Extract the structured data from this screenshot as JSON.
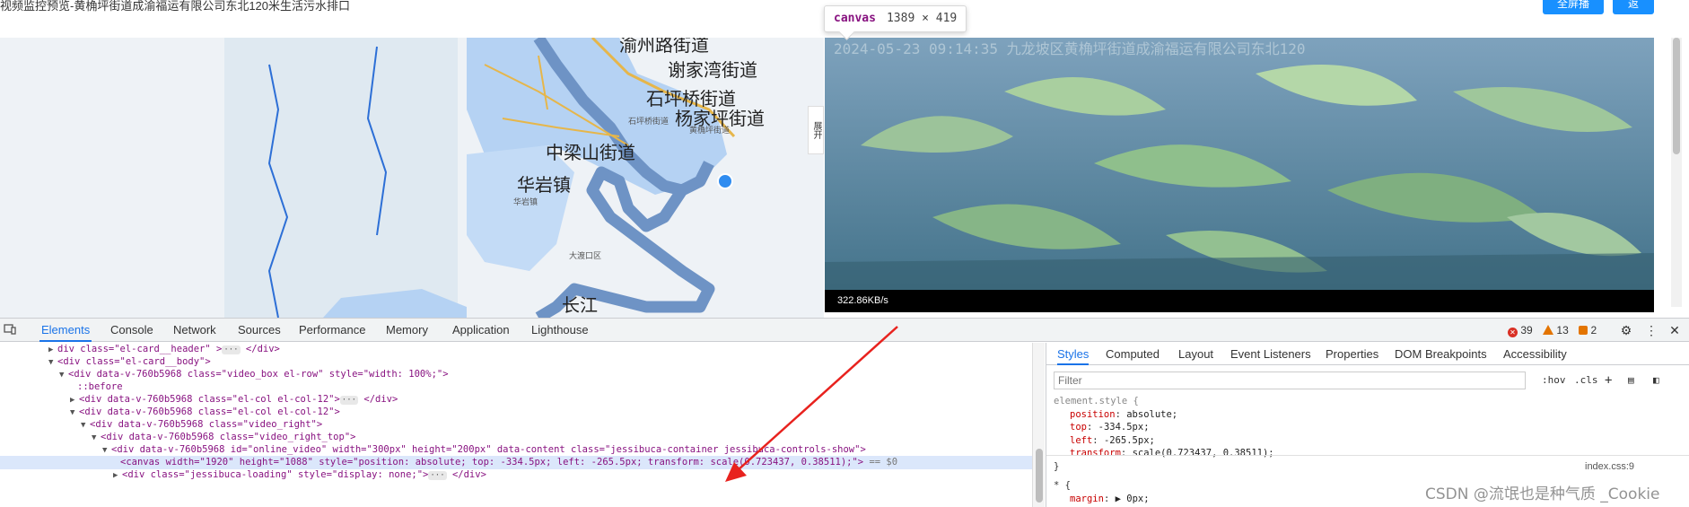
{
  "page": {
    "title": "视频监控预览-黄桷坪街道成渝福运有限公司东北120米生活污水排口",
    "fullscreen_label": "全屏播放",
    "back_label": "返回"
  },
  "tooltip": {
    "tag": "canvas",
    "dims": "1389 × 419"
  },
  "map": {
    "labels": [
      "渝州路街道",
      "谢家湾街道",
      "石坪桥街道",
      "杨家坪街道",
      "中梁山街道",
      "华岩镇",
      "长江"
    ],
    "small_labels": [
      "石坪桥街道",
      "黄桷坪街道",
      "华岩镇",
      "大渡口区"
    ],
    "collapse_label": "展开"
  },
  "video": {
    "bitrate": "322.86KB/s",
    "overlay_text": "2024-05-23 09:14:35    九龙坡区黄桷坪街道成渝福运有限公司东北120"
  },
  "devtools": {
    "tabs": [
      "Elements",
      "Console",
      "Network",
      "Sources",
      "Performance",
      "Memory",
      "Application",
      "Lighthouse"
    ],
    "issues": {
      "errors": "39",
      "warnings": "13",
      "info": "2"
    },
    "dom_lines": [
      {
        "prefix": "<",
        "text": "div class=\"el-card__header\" >",
        "suffix": "</div>"
      },
      {
        "text": "<div class=\"el-card__body\">"
      },
      {
        "text": "<div data-v-760b5968 class=\"video_box el-row\" style=\"width: 100%;\">"
      },
      {
        "text": "::before"
      },
      {
        "text": "<div data-v-760b5968 class=\"el-col el-col-12\">",
        "suffix": "</div>"
      },
      {
        "text": "<div data-v-760b5968 class=\"el-col el-col-12\">"
      },
      {
        "text": "<div data-v-760b5968 class=\"video_right\">"
      },
      {
        "text": "<div data-v-760b5968 class=\"video_right_top\">"
      },
      {
        "text": "<div data-v-760b5968 id=\"online_video\" width=\"300px\" height=\"200px\" data-content class=\"jessibuca-container jessibuca-controls-show\">"
      },
      {
        "text": "<canvas width=\"1920\" height=\"1088\" style=\"position: absolute; top: -334.5px; left: -265.5px; transform: scale(0.723437, 0.38511);\">",
        "suffix": "== $0"
      },
      {
        "text": "<div class=\"jessibuca-loading\" style=\"display: none;\">",
        "suffix": "</div>"
      }
    ],
    "styles_tabs": [
      "Styles",
      "Computed",
      "Layout",
      "Event Listeners",
      "Properties",
      "DOM Breakpoints",
      "Accessibility"
    ],
    "filter_placeholder": "Filter",
    "filter_tools": [
      ":hov",
      ".cls",
      "+"
    ],
    "element_style_selector": "element.style {",
    "css_props": [
      {
        "prop": "position",
        "value": "absolute;"
      },
      {
        "prop": "top",
        "value": "-334.5px;"
      },
      {
        "prop": "left",
        "value": "-265.5px;"
      },
      {
        "prop": "transform",
        "value": "scale(0.723437, 0.38511);"
      }
    ],
    "rule_close": "}",
    "universal_selector": "* {",
    "universal_prop": {
      "prop": "margin",
      "value": "0px;"
    },
    "css_source": "index.css:9"
  },
  "watermark": "CSDN @流氓也是种气质 _Cookie",
  "colors": {
    "accent": "#1a73e8",
    "button": "#1890ff",
    "arrow": "#e8221e"
  }
}
